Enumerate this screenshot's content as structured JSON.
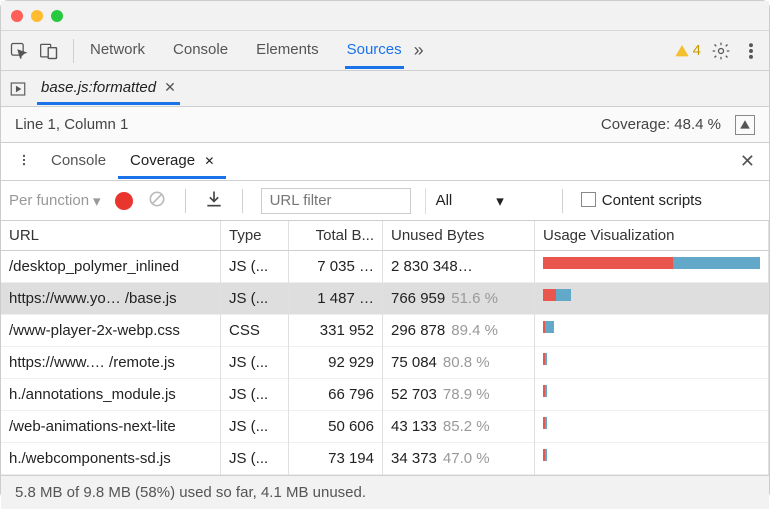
{
  "main_tabs": [
    "Network",
    "Console",
    "Elements",
    "Sources"
  ],
  "main_active": "Sources",
  "warn_count": "4",
  "doc_tab": "base.js:formatted",
  "status_left": "Line 1, Column 1",
  "status_right": "Coverage: 48.4 %",
  "drawer_tabs": [
    "Console",
    "Coverage"
  ],
  "drawer_active": "Coverage",
  "per_func": "Per function",
  "url_placeholder": "URL filter",
  "type_filter": "All",
  "content_scripts": "Content scripts",
  "columns": {
    "url": "URL",
    "type": "Type",
    "total": "Total B...",
    "unused": "Unused Bytes",
    "viz": "Usage Visualization"
  },
  "rows": [
    {
      "url": "/desktop_polymer_inlined",
      "type": "JS (...",
      "total": "7 035 …",
      "unused": "2 830 348…",
      "pct": "",
      "used_w": 60,
      "unused_w": 40,
      "full": true
    },
    {
      "url": "https://www.yo… /base.js",
      "type": "JS (...",
      "total": "1 487 …",
      "unused": "766 959",
      "pct": "51.6 %",
      "used_w": 6,
      "unused_w": 7,
      "selected": true
    },
    {
      "url": "/www-player-2x-webp.css",
      "type": "CSS",
      "total": "331 952",
      "unused": "296 878",
      "pct": "89.4 %",
      "used_w": 1,
      "unused_w": 4
    },
    {
      "url": "https://www.… /remote.js",
      "type": "JS (...",
      "total": "92 929",
      "unused": "75 084",
      "pct": "80.8 %",
      "used_w": 1,
      "unused_w": 1
    },
    {
      "url": "h./annotations_module.js",
      "type": "JS (...",
      "total": "66 796",
      "unused": "52 703",
      "pct": "78.9 %",
      "used_w": 1,
      "unused_w": 1
    },
    {
      "url": "/web-animations-next-lite",
      "type": "JS (...",
      "total": "50 606",
      "unused": "43 133",
      "pct": "85.2 %",
      "used_w": 1,
      "unused_w": 1
    },
    {
      "url": "h./webcomponents-sd.js",
      "type": "JS (...",
      "total": "73 194",
      "unused": "34 373",
      "pct": "47.0 %",
      "used_w": 1,
      "unused_w": 1
    }
  ],
  "footer": "5.8 MB of 9.8 MB (58%) used so far, 4.1 MB unused."
}
